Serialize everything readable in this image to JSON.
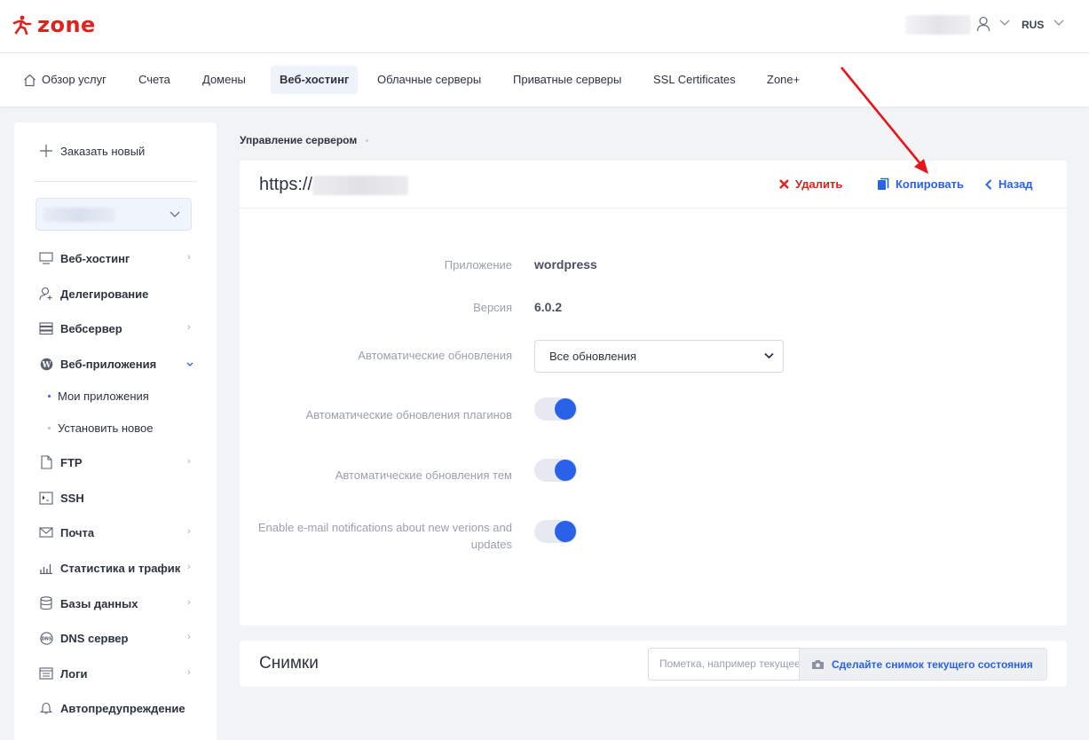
{
  "brand": {
    "logo_text": "zone",
    "accent": "#e0211d",
    "primary": "#2962e8"
  },
  "header": {
    "language": "RUS"
  },
  "nav": {
    "items": [
      {
        "label": "Обзор услуг",
        "icon": "home-icon"
      },
      {
        "label": "Счета"
      },
      {
        "label": "Домены"
      },
      {
        "label": "Веб-хостинг",
        "active": true
      },
      {
        "label": "Облачные серверы"
      },
      {
        "label": "Приватные серверы"
      },
      {
        "label": "SSL Certificates"
      },
      {
        "label": "Zone+"
      }
    ]
  },
  "sidebar": {
    "order_new": "Заказать новый",
    "items": [
      {
        "label": "Веб-хостинг",
        "icon": "monitor-icon"
      },
      {
        "label": "Делегирование",
        "icon": "user-add-icon"
      },
      {
        "label": "Вебсервер",
        "icon": "server-icon"
      },
      {
        "label": "Веб-приложения",
        "icon": "wordpress-icon",
        "expanded": true
      },
      {
        "label": "FTP",
        "icon": "file-icon"
      },
      {
        "label": "SSH",
        "icon": "terminal-icon"
      },
      {
        "label": "Почта",
        "icon": "mail-icon"
      },
      {
        "label": "Статистика и трафик",
        "icon": "chart-icon"
      },
      {
        "label": "Базы данных",
        "icon": "database-icon"
      },
      {
        "label": "DNS сервер",
        "icon": "dns-icon"
      },
      {
        "label": "Логи",
        "icon": "logs-icon"
      },
      {
        "label": "Автопредупреждение",
        "icon": "bell-icon"
      }
    ],
    "subitems": [
      {
        "label": "Мои приложения",
        "active": true
      },
      {
        "label": "Установить новое"
      }
    ]
  },
  "breadcrumb": {
    "current": "Управление сервером"
  },
  "site": {
    "url_prefix": "https://",
    "actions": {
      "delete": "Удалить",
      "copy": "Копировать",
      "back": "Назад"
    }
  },
  "details": {
    "app_label": "Приложение",
    "app_value": "wordpress",
    "version_label": "Версия",
    "version_value": "6.0.2",
    "auto_updates_label": "Автоматические обновления",
    "auto_updates_value": "Все обновления",
    "plugins_label": "Автоматические обновления плагинов",
    "plugins_on": true,
    "themes_label": "Автоматические обновления тем",
    "themes_on": true,
    "email_label_1": "Enable e-mail notifications about new verions and",
    "email_label_2": "updates",
    "email_on": true
  },
  "snapshots": {
    "title": "Снимки",
    "input_placeholder": "Пометка, например текущее состояние",
    "button_label": "Сделайте снимок текущего состояния"
  }
}
